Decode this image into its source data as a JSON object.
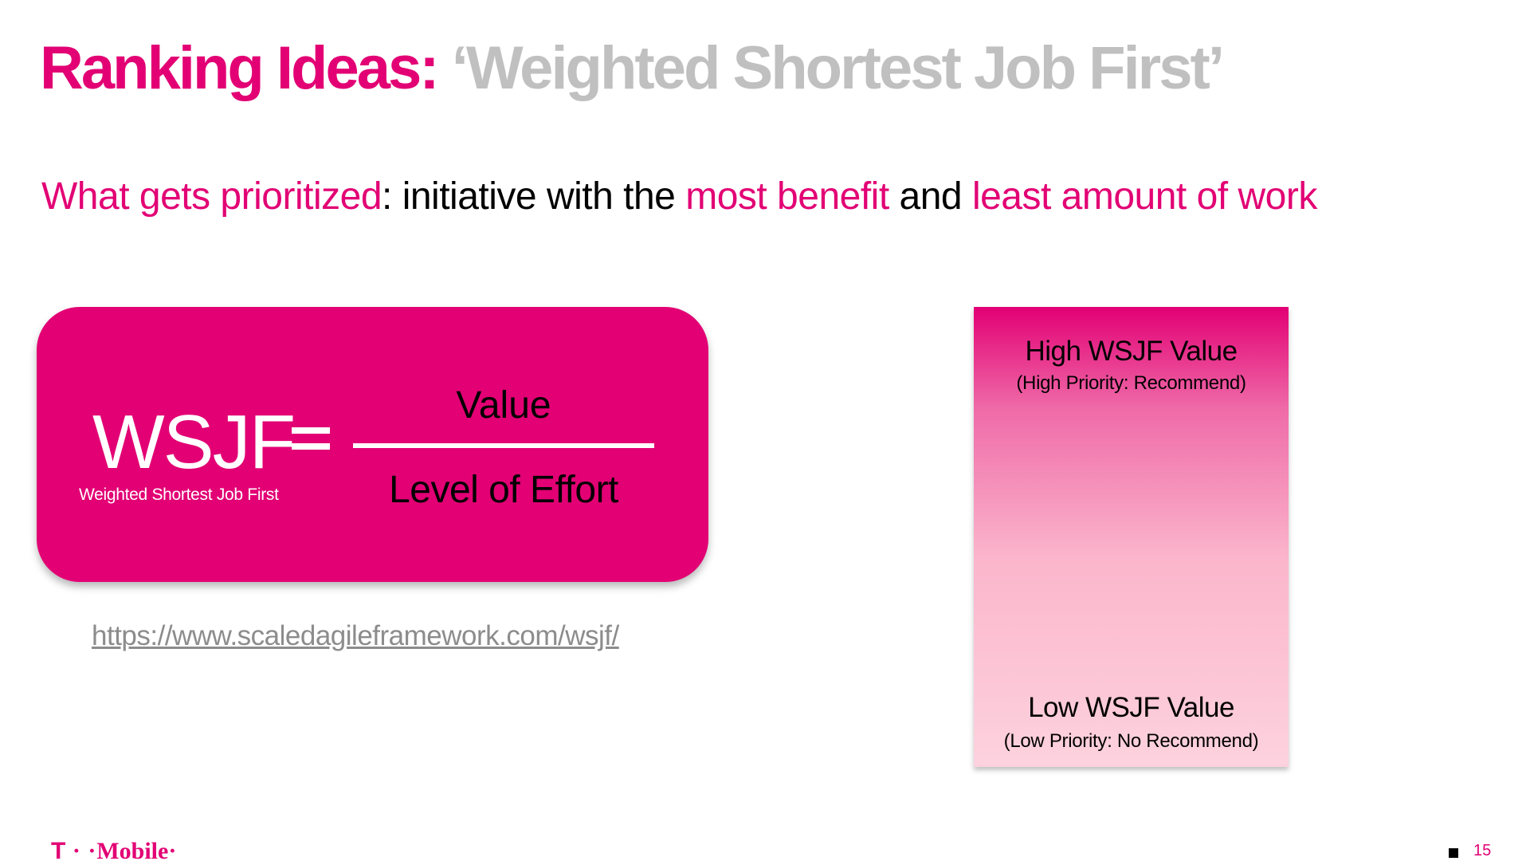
{
  "title": {
    "part1": "Ranking Ideas:",
    "part2": "‘Weighted Shortest Job First’"
  },
  "subtitle": {
    "seg1": "What gets prioritized",
    "seg2": ": initiative with the ",
    "seg3": "most benefit",
    "seg4": " and ",
    "seg5": "least amount of work"
  },
  "formula": {
    "term": "WSJF",
    "term_expansion": "Weighted Shortest Job First",
    "numerator": "Value",
    "denominator": "Level of Effort"
  },
  "link": "https://www.scaledagileframework.com/wsjf/",
  "scale": {
    "high_title": "High WSJF Value",
    "high_subtitle": "(High Priority: Recommend)",
    "low_title": "Low WSJF Value",
    "low_subtitle": "(Low Priority: No Recommend)"
  },
  "footer": {
    "logo_t": "T",
    "logo_dots": " · ·",
    "logo_text": "Mobile",
    "logo_end": "·",
    "page_number": "15"
  },
  "colors": {
    "brand_magenta": "#e20074",
    "title_gray": "#c0c0c0",
    "link_gray": "#8c8c8c"
  }
}
